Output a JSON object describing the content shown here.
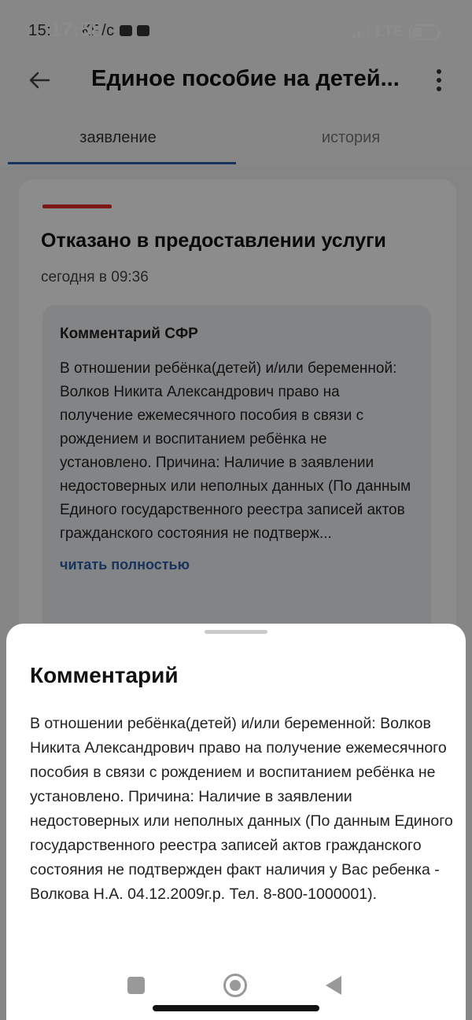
{
  "status_bar": {
    "time": "17:58",
    "under_text": "15:",
    "speed": "КБ/с",
    "network": "LTE"
  },
  "app_bar": {
    "title": "Единое пособие на детей..."
  },
  "tabs": [
    {
      "label": "заявление",
      "active": true
    },
    {
      "label": "история",
      "active": false
    }
  ],
  "card": {
    "status": "Отказано в предоставлении услуги",
    "time": "сегодня в 09:36",
    "comment_heading": "Комментарий СФР",
    "comment_preview": "В отношении ребёнка(детей) и/или беременной: Волков Никита Александрович право на получение ежемесячного пособия в связи с рождением и воспитанием ребёнка не установлено. Причина: Наличие в заявлении недостоверных или неполных данных (По данным Единого государственного реестра записей актов гражданского состояния не подтверж...",
    "read_more": "читать полностью"
  },
  "sheet": {
    "title": "Комментарий",
    "text": "В отношении ребёнка(детей) и/или беременной: Волков Никита Александрович право на получение ежемесячного пособия в связи с рождением и воспитанием ребёнка не установлено. Причина: Наличие в заявлении недостоверных или неполных данных (По данным Единого государственного реестра записей актов гражданского состояния не подтвержден факт наличия у Вас ребенка - Волкова Н.А. 04.12.2009г.р. Тел. 8-800-1000001)."
  },
  "colors": {
    "accent": "#2d5ea8",
    "danger": "#e02b2b"
  }
}
